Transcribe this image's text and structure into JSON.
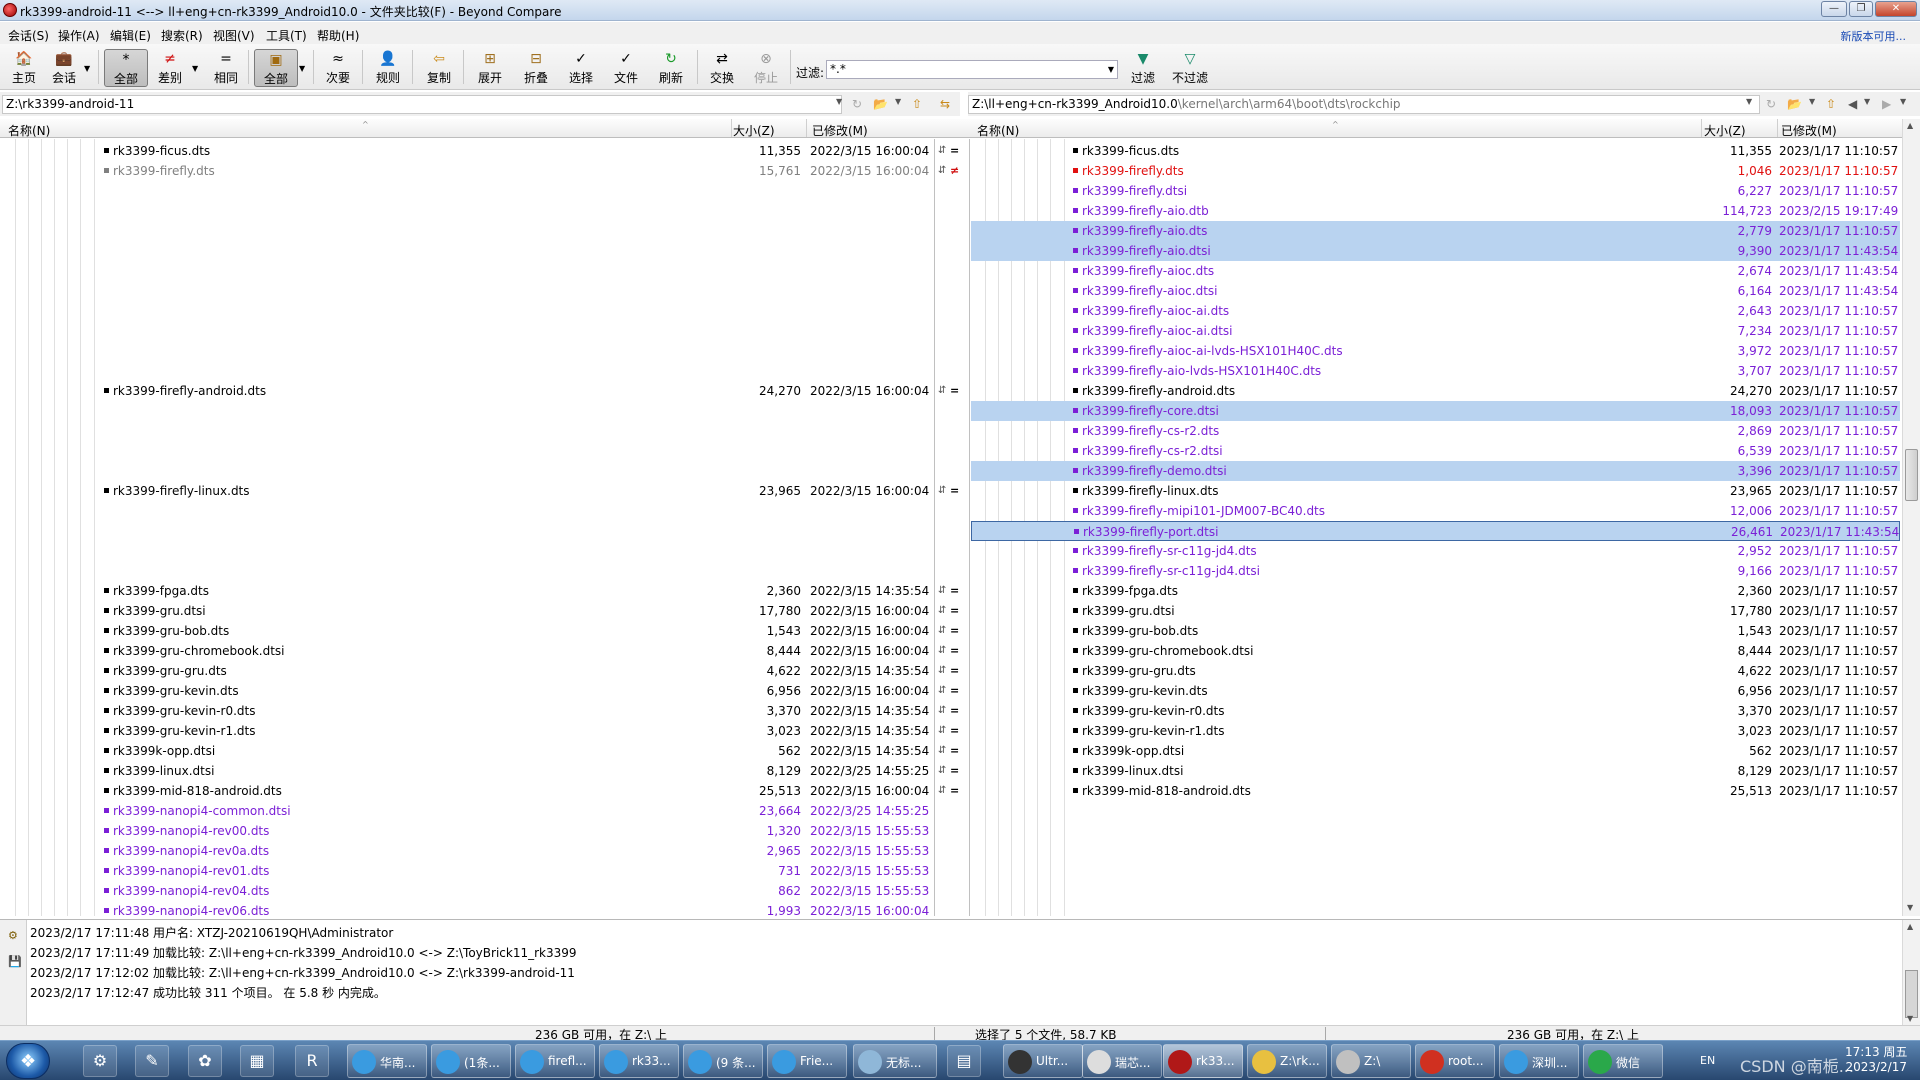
{
  "window": {
    "title": "rk3399-android-11 <--> ll+eng+cn-rk3399_Android10.0 - 文件夹比较(F) - Beyond Compare",
    "minimize": "—",
    "maximize": "❐",
    "close": "✕"
  },
  "menu": {
    "items": [
      "会话(S)",
      "操作(A)",
      "编辑(E)",
      "搜索(R)",
      "视图(V)",
      "工具(T)",
      "帮助(H)"
    ],
    "new_version": "新版本可用..."
  },
  "toolbar": {
    "buttons": [
      {
        "label": "主页",
        "icon": "home-icon",
        "glyph": "🏠"
      },
      {
        "label": "会话",
        "icon": "session-icon",
        "glyph": "💼"
      },
      {
        "label": "全部",
        "icon": "show-all-icon",
        "glyph": "*",
        "selected": true
      },
      {
        "label": "差别",
        "icon": "show-diff-icon",
        "glyph": "≠"
      },
      {
        "label": "相同",
        "icon": "show-same-icon",
        "glyph": "="
      },
      {
        "label": "全部",
        "icon": "all-files-icon",
        "glyph": "▣",
        "selected": true
      },
      {
        "label": "次要",
        "icon": "minor-icon",
        "glyph": "≈"
      },
      {
        "label": "规则",
        "icon": "rules-icon",
        "glyph": "👤"
      },
      {
        "label": "复制",
        "icon": "copy-icon",
        "glyph": "⇦"
      },
      {
        "label": "展开",
        "icon": "expand-icon",
        "glyph": "⊞"
      },
      {
        "label": "折叠",
        "icon": "collapse-icon",
        "glyph": "⊟"
      },
      {
        "label": "选择",
        "icon": "select-icon",
        "glyph": "✓"
      },
      {
        "label": "文件",
        "icon": "files-icon",
        "glyph": "✓"
      },
      {
        "label": "刷新",
        "icon": "refresh-icon",
        "glyph": "↻"
      },
      {
        "label": "交换",
        "icon": "swap-icon",
        "glyph": "⇄"
      },
      {
        "label": "停止",
        "icon": "stop-icon",
        "glyph": "⊗",
        "disabled": true
      },
      {
        "label": "过滤",
        "icon": "filter-icon",
        "glyph": "▼"
      },
      {
        "label": "不过滤",
        "icon": "no-filter-icon",
        "glyph": "▽"
      }
    ],
    "filter_label": "过滤:",
    "filter_value": "*.*"
  },
  "left": {
    "path": "Z:\\rk3399-android-11",
    "columns": {
      "name": "名称(N)",
      "size": "大小(Z)",
      "modified": "已修改(M)"
    },
    "rows": [
      {
        "r": 0,
        "name": "rk3399-ficus.dts",
        "size": "11,355",
        "date": "2022/3/15 16:00:04",
        "color": "#000000",
        "cmp": "="
      },
      {
        "r": 1,
        "name": "rk3399-firefly.dts",
        "size": "15,761",
        "date": "2022/3/15 16:00:04",
        "color": "#808080",
        "cmp": "≠"
      },
      {
        "r": 12,
        "name": "rk3399-firefly-android.dts",
        "size": "24,270",
        "date": "2022/3/15 16:00:04",
        "color": "#000000",
        "cmp": "="
      },
      {
        "r": 17,
        "name": "rk3399-firefly-linux.dts",
        "size": "23,965",
        "date": "2022/3/15 16:00:04",
        "color": "#000000",
        "cmp": "="
      },
      {
        "r": 22,
        "name": "rk3399-fpga.dts",
        "size": "2,360",
        "date": "2022/3/15 14:35:54",
        "color": "#000000",
        "cmp": "="
      },
      {
        "r": 23,
        "name": "rk3399-gru.dtsi",
        "size": "17,780",
        "date": "2022/3/15 16:00:04",
        "color": "#000000",
        "cmp": "="
      },
      {
        "r": 24,
        "name": "rk3399-gru-bob.dts",
        "size": "1,543",
        "date": "2022/3/15 16:00:04",
        "color": "#000000",
        "cmp": "="
      },
      {
        "r": 25,
        "name": "rk3399-gru-chromebook.dtsi",
        "size": "8,444",
        "date": "2022/3/15 16:00:04",
        "color": "#000000",
        "cmp": "="
      },
      {
        "r": 26,
        "name": "rk3399-gru-gru.dts",
        "size": "4,622",
        "date": "2022/3/15 14:35:54",
        "color": "#000000",
        "cmp": "="
      },
      {
        "r": 27,
        "name": "rk3399-gru-kevin.dts",
        "size": "6,956",
        "date": "2022/3/15 16:00:04",
        "color": "#000000",
        "cmp": "="
      },
      {
        "r": 28,
        "name": "rk3399-gru-kevin-r0.dts",
        "size": "3,370",
        "date": "2022/3/15 14:35:54",
        "color": "#000000",
        "cmp": "="
      },
      {
        "r": 29,
        "name": "rk3399-gru-kevin-r1.dts",
        "size": "3,023",
        "date": "2022/3/15 14:35:54",
        "color": "#000000",
        "cmp": "="
      },
      {
        "r": 30,
        "name": "rk3399k-opp.dtsi",
        "size": "562",
        "date": "2022/3/15 14:35:54",
        "color": "#000000",
        "cmp": "="
      },
      {
        "r": 31,
        "name": "rk3399-linux.dtsi",
        "size": "8,129",
        "date": "2022/3/25 14:55:25",
        "color": "#000000",
        "cmp": "="
      },
      {
        "r": 32,
        "name": "rk3399-mid-818-android.dts",
        "size": "25,513",
        "date": "2022/3/15 16:00:04",
        "color": "#000000",
        "cmp": "="
      },
      {
        "r": 33,
        "name": "rk3399-nanopi4-common.dtsi",
        "size": "23,664",
        "date": "2022/3/25 14:55:25",
        "color": "#7b1fd6",
        "cmp": ""
      },
      {
        "r": 34,
        "name": "rk3399-nanopi4-rev00.dts",
        "size": "1,320",
        "date": "2022/3/15 15:55:53",
        "color": "#7b1fd6",
        "cmp": ""
      },
      {
        "r": 35,
        "name": "rk3399-nanopi4-rev0a.dts",
        "size": "2,965",
        "date": "2022/3/15 15:55:53",
        "color": "#7b1fd6",
        "cmp": ""
      },
      {
        "r": 36,
        "name": "rk3399-nanopi4-rev01.dts",
        "size": "731",
        "date": "2022/3/15 15:55:53",
        "color": "#7b1fd6",
        "cmp": ""
      },
      {
        "r": 37,
        "name": "rk3399-nanopi4-rev04.dts",
        "size": "862",
        "date": "2022/3/15 15:55:53",
        "color": "#7b1fd6",
        "cmp": ""
      },
      {
        "r": 38,
        "name": "rk3399-nanopi4-rev06.dts",
        "size": "1,993",
        "date": "2022/3/15 16:00:04",
        "color": "#7b1fd6",
        "cmp": ""
      }
    ]
  },
  "right": {
    "path_prefix": "Z:\\ll+eng+cn-rk3399_Android10.0",
    "path_suffix": "\\kernel\\arch\\arm64\\boot\\dts\\rockchip",
    "columns": {
      "name": "名称(N)",
      "size": "大小(Z)",
      "modified": "已修改(M)"
    },
    "rows": [
      {
        "r": 0,
        "name": "rk3399-ficus.dts",
        "size": "11,355",
        "date": "2023/1/17 11:10:57",
        "color": "#000000"
      },
      {
        "r": 1,
        "name": "rk3399-firefly.dts",
        "size": "1,046",
        "date": "2023/1/17 11:10:57",
        "color": "#e01010"
      },
      {
        "r": 2,
        "name": "rk3399-firefly.dtsi",
        "size": "6,227",
        "date": "2023/1/17 11:10:57",
        "color": "#7b1fd6"
      },
      {
        "r": 3,
        "name": "rk3399-firefly-aio.dtb",
        "size": "114,723",
        "date": "2023/2/15 19:17:49",
        "color": "#7b1fd6"
      },
      {
        "r": 4,
        "name": "rk3399-firefly-aio.dts",
        "size": "2,779",
        "date": "2023/1/17 11:10:57",
        "color": "#7b1fd6",
        "sel": true
      },
      {
        "r": 5,
        "name": "rk3399-firefly-aio.dtsi",
        "size": "9,390",
        "date": "2023/1/17 11:43:54",
        "color": "#7b1fd6",
        "sel": true
      },
      {
        "r": 6,
        "name": "rk3399-firefly-aioc.dts",
        "size": "2,674",
        "date": "2023/1/17 11:43:54",
        "color": "#7b1fd6"
      },
      {
        "r": 7,
        "name": "rk3399-firefly-aioc.dtsi",
        "size": "6,164",
        "date": "2023/1/17 11:43:54",
        "color": "#7b1fd6"
      },
      {
        "r": 8,
        "name": "rk3399-firefly-aioc-ai.dts",
        "size": "2,643",
        "date": "2023/1/17 11:10:57",
        "color": "#7b1fd6"
      },
      {
        "r": 9,
        "name": "rk3399-firefly-aioc-ai.dtsi",
        "size": "7,234",
        "date": "2023/1/17 11:10:57",
        "color": "#7b1fd6"
      },
      {
        "r": 10,
        "name": "rk3399-firefly-aioc-ai-lvds-HSX101H40C.dts",
        "size": "3,972",
        "date": "2023/1/17 11:10:57",
        "color": "#7b1fd6"
      },
      {
        "r": 11,
        "name": "rk3399-firefly-aio-lvds-HSX101H40C.dts",
        "size": "3,707",
        "date": "2023/1/17 11:10:57",
        "color": "#7b1fd6"
      },
      {
        "r": 12,
        "name": "rk3399-firefly-android.dts",
        "size": "24,270",
        "date": "2023/1/17 11:10:57",
        "color": "#000000"
      },
      {
        "r": 13,
        "name": "rk3399-firefly-core.dtsi",
        "size": "18,093",
        "date": "2023/1/17 11:10:57",
        "color": "#7b1fd6",
        "sel": true
      },
      {
        "r": 14,
        "name": "rk3399-firefly-cs-r2.dts",
        "size": "2,869",
        "date": "2023/1/17 11:10:57",
        "color": "#7b1fd6"
      },
      {
        "r": 15,
        "name": "rk3399-firefly-cs-r2.dtsi",
        "size": "6,539",
        "date": "2023/1/17 11:10:57",
        "color": "#7b1fd6"
      },
      {
        "r": 16,
        "name": "rk3399-firefly-demo.dtsi",
        "size": "3,396",
        "date": "2023/1/17 11:10:57",
        "color": "#7b1fd6",
        "sel": true
      },
      {
        "r": 17,
        "name": "rk3399-firefly-linux.dts",
        "size": "23,965",
        "date": "2023/1/17 11:10:57",
        "color": "#000000"
      },
      {
        "r": 18,
        "name": "rk3399-firefly-mipi101-JDM007-BC40.dts",
        "size": "12,006",
        "date": "2023/1/17 11:10:57",
        "color": "#7b1fd6"
      },
      {
        "r": 19,
        "name": "rk3399-firefly-port.dtsi",
        "size": "26,461",
        "date": "2023/1/17 11:43:54",
        "color": "#7b1fd6",
        "sel": true,
        "focus": true
      },
      {
        "r": 20,
        "name": "rk3399-firefly-sr-c11g-jd4.dts",
        "size": "2,952",
        "date": "2023/1/17 11:10:57",
        "color": "#7b1fd6"
      },
      {
        "r": 21,
        "name": "rk3399-firefly-sr-c11g-jd4.dtsi",
        "size": "9,166",
        "date": "2023/1/17 11:10:57",
        "color": "#7b1fd6"
      },
      {
        "r": 22,
        "name": "rk3399-fpga.dts",
        "size": "2,360",
        "date": "2023/1/17 11:10:57",
        "color": "#000000"
      },
      {
        "r": 23,
        "name": "rk3399-gru.dtsi",
        "size": "17,780",
        "date": "2023/1/17 11:10:57",
        "color": "#000000"
      },
      {
        "r": 24,
        "name": "rk3399-gru-bob.dts",
        "size": "1,543",
        "date": "2023/1/17 11:10:57",
        "color": "#000000"
      },
      {
        "r": 25,
        "name": "rk3399-gru-chromebook.dtsi",
        "size": "8,444",
        "date": "2023/1/17 11:10:57",
        "color": "#000000"
      },
      {
        "r": 26,
        "name": "rk3399-gru-gru.dts",
        "size": "4,622",
        "date": "2023/1/17 11:10:57",
        "color": "#000000"
      },
      {
        "r": 27,
        "name": "rk3399-gru-kevin.dts",
        "size": "6,956",
        "date": "2023/1/17 11:10:57",
        "color": "#000000"
      },
      {
        "r": 28,
        "name": "rk3399-gru-kevin-r0.dts",
        "size": "3,370",
        "date": "2023/1/17 11:10:57",
        "color": "#000000"
      },
      {
        "r": 29,
        "name": "rk3399-gru-kevin-r1.dts",
        "size": "3,023",
        "date": "2023/1/17 11:10:57",
        "color": "#000000"
      },
      {
        "r": 30,
        "name": "rk3399k-opp.dtsi",
        "size": "562",
        "date": "2023/1/17 11:10:57",
        "color": "#000000"
      },
      {
        "r": 31,
        "name": "rk3399-linux.dtsi",
        "size": "8,129",
        "date": "2023/1/17 11:10:57",
        "color": "#000000"
      },
      {
        "r": 32,
        "name": "rk3399-mid-818-android.dts",
        "size": "25,513",
        "date": "2023/1/17 11:10:57",
        "color": "#000000"
      }
    ]
  },
  "log": [
    "2023/2/17 17:11:48  用户名: XTZJ-20210619QH\\Administrator",
    "2023/2/17 17:11:49  加载比较: Z:\\ll+eng+cn-rk3399_Android10.0 <-> Z:\\ToyBrick11_rk3399",
    "2023/2/17 17:12:02  加载比较: Z:\\ll+eng+cn-rk3399_Android10.0 <-> Z:\\rk3399-android-11",
    "2023/2/17 17:12:47  成功比较 311 个项目。 在 5.8 秒 内完成。"
  ],
  "status": {
    "left_free": "236 GB 可用，在 Z:\\ 上",
    "selection": "选择了 5 个文件, 58.7 KB",
    "right_free": "236 GB 可用，在 Z:\\ 上"
  },
  "taskbar": {
    "tasks": [
      {
        "label": "华南...",
        "color": "#3a9be0"
      },
      {
        "label": "(1条...",
        "color": "#3a9be0"
      },
      {
        "label": "firefl...",
        "color": "#3a9be0"
      },
      {
        "label": "rk33...",
        "color": "#3a9be0"
      },
      {
        "label": "(9 条...",
        "color": "#3a9be0"
      },
      {
        "label": "Frie...",
        "color": "#3a9be0"
      },
      {
        "label": "无标...",
        "color": "#8fb7d8"
      },
      {
        "label": "Ultr...",
        "color": "#333333"
      },
      {
        "label": "瑞芯...",
        "color": "#dddddd"
      },
      {
        "label": "rk33...",
        "color": "#b01818",
        "active": true
      },
      {
        "label": "Z:\\rk...",
        "color": "#e8c040"
      },
      {
        "label": "Z:\\",
        "color": "#c0c0c0"
      },
      {
        "label": "root...",
        "color": "#d03020"
      },
      {
        "label": "深圳...",
        "color": "#3a9be0"
      },
      {
        "label": "微信",
        "color": "#2aa84a"
      }
    ],
    "lang": "EN",
    "watermark": "CSDN @南栀...",
    "time": "17:13 周五",
    "date": "2023/2/17"
  }
}
